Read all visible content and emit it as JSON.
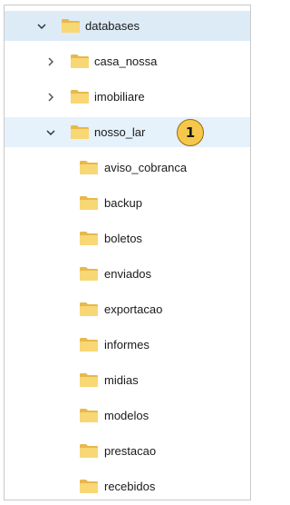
{
  "tree": {
    "root": {
      "label": "databases",
      "expanded": true,
      "chevron_icon": "chevron-down-icon"
    },
    "children": [
      {
        "label": "casa_nossa",
        "expanded": false,
        "chevron_icon": "chevron-right-icon"
      },
      {
        "label": "imobiliare",
        "expanded": false,
        "chevron_icon": "chevron-right-icon"
      },
      {
        "label": "nosso_lar",
        "expanded": true,
        "chevron_icon": "chevron-down-icon",
        "badge": "1"
      }
    ],
    "nosso_lar_children": [
      {
        "label": "aviso_cobranca"
      },
      {
        "label": "backup"
      },
      {
        "label": "boletos"
      },
      {
        "label": "enviados"
      },
      {
        "label": "exportacao"
      },
      {
        "label": "informes"
      },
      {
        "label": "midias"
      },
      {
        "label": "modelos"
      },
      {
        "label": "prestacao"
      },
      {
        "label": "recebidos"
      }
    ]
  },
  "colors": {
    "folder_fill": "#f8d775",
    "folder_tab": "#e8b84a",
    "selected_bg": "#ddebf7",
    "badge_fill": "#f5c84b"
  }
}
